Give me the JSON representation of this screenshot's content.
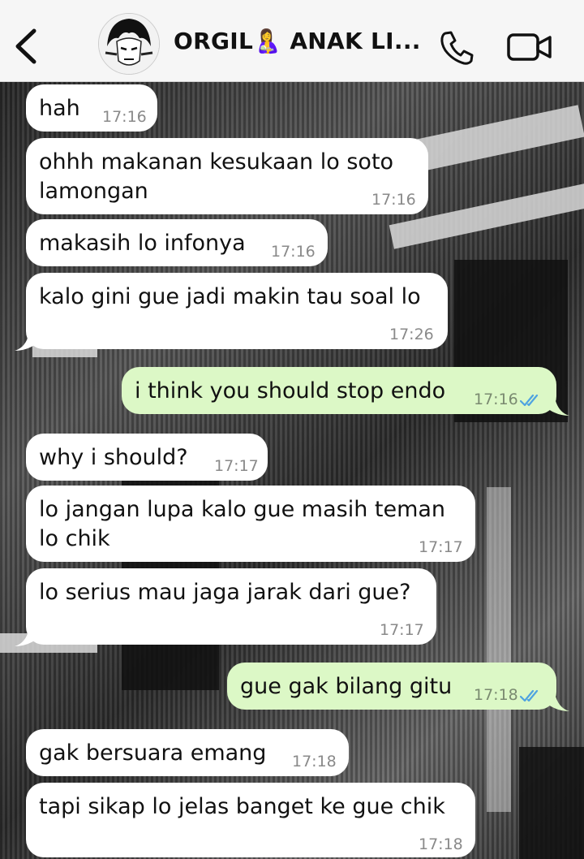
{
  "header": {
    "title": "ORGIL🤱 ANAK LI...",
    "back_icon": "chevron-left-icon",
    "call_icon": "phone-icon",
    "video_icon": "video-camera-icon",
    "avatar": "group-avatar"
  },
  "colors": {
    "incoming_bubble": "#ffffff",
    "outgoing_bubble": "#dcf8c6",
    "read_ticks": "#4fa3e0",
    "header_bg": "#f6f6f6"
  },
  "messages": [
    {
      "direction": "in",
      "lines": [
        "hah"
      ],
      "time": "17:16"
    },
    {
      "direction": "in",
      "lines": [
        "ohhh makanan kesukaan lo soto",
        "lamongan"
      ],
      "time": "17:16"
    },
    {
      "direction": "in",
      "lines": [
        "makasih lo infonya"
      ],
      "time": "17:16"
    },
    {
      "direction": "in",
      "lines": [
        "kalo gini gue jadi makin tau soal lo"
      ],
      "time": "17:26"
    },
    {
      "direction": "out",
      "lines": [
        "i think you should stop endo"
      ],
      "time": "17:16",
      "status": "read"
    },
    {
      "direction": "in",
      "lines": [
        "why i should?"
      ],
      "time": "17:17"
    },
    {
      "direction": "in",
      "lines": [
        "lo jangan lupa kalo gue masih teman",
        "lo chik"
      ],
      "time": "17:17"
    },
    {
      "direction": "in",
      "lines": [
        "lo serius mau jaga jarak dari gue?"
      ],
      "time": "17:17"
    },
    {
      "direction": "out",
      "lines": [
        "gue gak bilang gitu"
      ],
      "time": "17:18",
      "status": "read"
    },
    {
      "direction": "in",
      "lines": [
        "gak bersuara emang"
      ],
      "time": "17:18"
    },
    {
      "direction": "in",
      "lines": [
        "tapi sikap lo jelas banget ke gue chik"
      ],
      "time": "17:18"
    }
  ]
}
